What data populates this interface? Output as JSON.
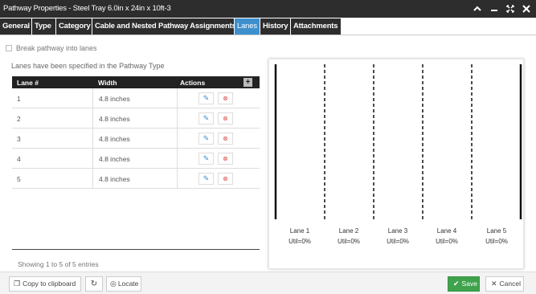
{
  "window": {
    "title": "Pathway Properties - Steel Tray 6.0in x 24in x 10ft-3",
    "controls": {
      "up": "▲",
      "minimize": "–",
      "maximize": "⤢",
      "close": "✕"
    }
  },
  "tabs": [
    {
      "label": "General"
    },
    {
      "label": "Type"
    },
    {
      "label": "Category"
    },
    {
      "label": "Cable and Nested Pathway Assignments"
    },
    {
      "label": "Lanes",
      "active": true
    },
    {
      "label": "History"
    },
    {
      "label": "Attachments"
    }
  ],
  "break_lanes": {
    "label": "Break pathway into lanes",
    "checked": false
  },
  "info_text": "Lanes have been specified in the Pathway Type",
  "grid": {
    "columns": {
      "lane": "Lane #",
      "width": "Width",
      "actions": "Actions"
    },
    "add_icon": "+",
    "rows": [
      {
        "lane": "1",
        "width": "4.8 inches"
      },
      {
        "lane": "2",
        "width": "4.8 inches"
      },
      {
        "lane": "3",
        "width": "4.8 inches"
      },
      {
        "lane": "4",
        "width": "4.8 inches"
      },
      {
        "lane": "5",
        "width": "4.8 inches"
      }
    ],
    "edit_icon": "pencil-icon",
    "delete_icon": "remove-circle-icon"
  },
  "entries_text": "Showing 1 to 5 of 5 entries",
  "lanes_diagram": {
    "lanes": [
      {
        "label": "Lane 1",
        "util": "Util=0%"
      },
      {
        "label": "Lane 2",
        "util": "Util=0%"
      },
      {
        "label": "Lane 3",
        "util": "Util=0%"
      },
      {
        "label": "Lane 4",
        "util": "Util=0%"
      },
      {
        "label": "Lane 5",
        "util": "Util=0%"
      }
    ]
  },
  "footer": {
    "copy": "Copy to clipboard",
    "refresh_icon": "refresh-icon",
    "locate": "Locate",
    "save": "Save",
    "cancel": "Cancel"
  },
  "colors": {
    "titlebar": "#2d2d2d",
    "active_tab": "#3d8fce",
    "save": "#3fa34d",
    "delete": "#d9534f"
  }
}
